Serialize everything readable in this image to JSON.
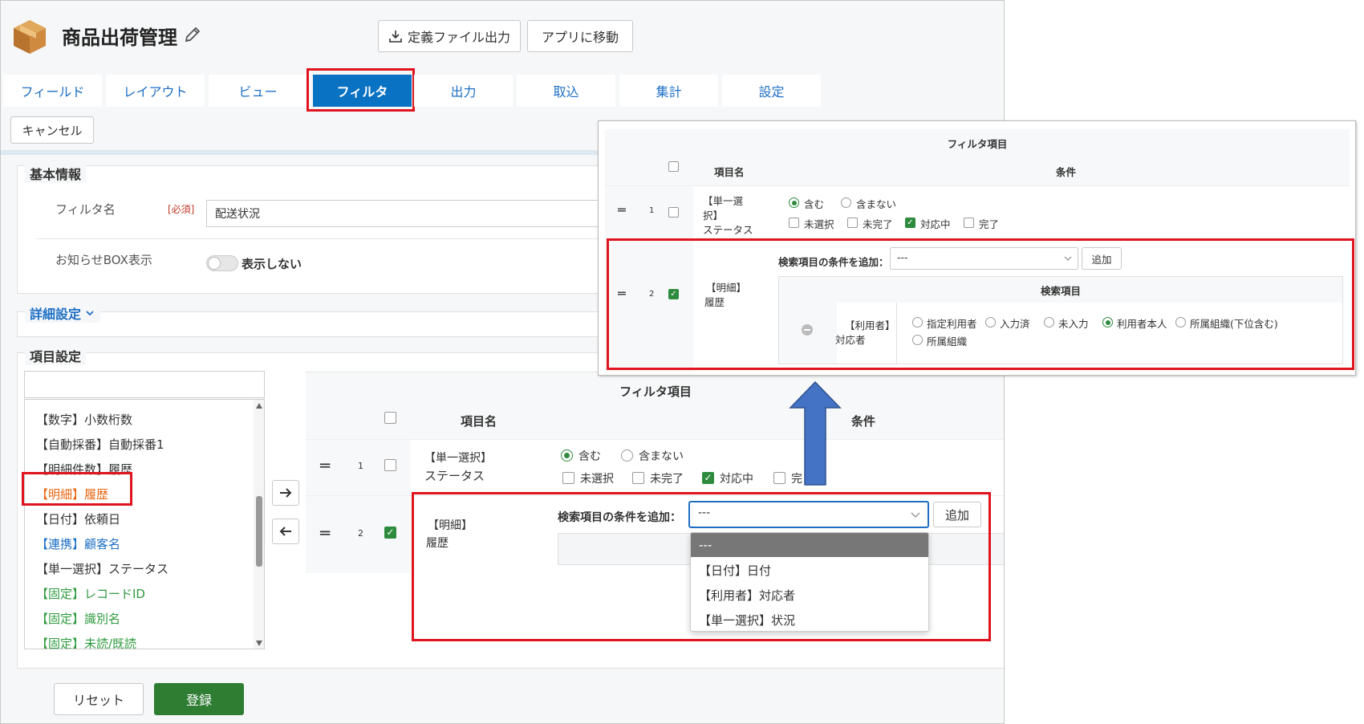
{
  "app": {
    "title": "商品出荷管理",
    "export_button": "定義ファイル出力",
    "goto_app_button": "アプリに移動",
    "cancel_button": "キャンセル"
  },
  "tabs": [
    {
      "label": "フィールド"
    },
    {
      "label": "レイアウト"
    },
    {
      "label": "ビュー"
    },
    {
      "label": "フィルタ"
    },
    {
      "label": "出力"
    },
    {
      "label": "取込"
    },
    {
      "label": "集計"
    },
    {
      "label": "設定"
    }
  ],
  "basic": {
    "section_title": "基本情報",
    "filter_name_label": "フィルタ名",
    "required": "[必須]",
    "filter_name_value": "配送状況",
    "notice_label": "お知らせBOX表示",
    "notice_toggle_text": "表示しない"
  },
  "detail": {
    "label": "詳細設定"
  },
  "items": {
    "section_title": "項目設定",
    "search_placeholder": "",
    "field_list": [
      {
        "label": "【数字】小数桁数",
        "color": "#333333"
      },
      {
        "label": "【自動採番】自動採番1",
        "color": "#333333"
      },
      {
        "label": "【明細件数】履歴",
        "color": "#333333"
      },
      {
        "label": "【明細】履歴",
        "color": "#e8650f"
      },
      {
        "label": "【日付】依頼日",
        "color": "#333333"
      },
      {
        "label": "【連携】顧客名",
        "color": "#1e6fc4"
      },
      {
        "label": "【単一選択】ステータス",
        "color": "#333333"
      },
      {
        "label": "【固定】レコードID",
        "color": "#2e9a3e"
      },
      {
        "label": "【固定】識別名",
        "color": "#2e9a3e"
      },
      {
        "label": "【固定】未読/既読",
        "color": "#2e9a3e"
      }
    ]
  },
  "filter_table": {
    "header": "フィルタ項目",
    "col_name": "項目名",
    "col_cond": "条件",
    "row1": {
      "num": "1",
      "name_line1": "【単一選択】",
      "name_line2": "ステータス",
      "radio_include": "含む",
      "radio_exclude": "含まない",
      "opts": [
        "未選択",
        "未完了",
        "対応中",
        "完"
      ]
    },
    "row2": {
      "num": "2",
      "name_line1": "【明細】",
      "name_line2": "履歴",
      "add_label": "検索項目の条件を追加：",
      "select_value": "---",
      "add_button": "追加"
    },
    "dropdown_options": [
      "---",
      "【日付】日付",
      "【利用者】対応者",
      "【単一選択】状況"
    ]
  },
  "inset": {
    "header": "フィルタ項目",
    "col_name": "項目名",
    "col_cond": "条件",
    "row1": {
      "num": "1",
      "name_lines": [
        "【単一選",
        "択】",
        "ステータス"
      ],
      "radio_include": "含む",
      "radio_exclude": "含まない",
      "opts": [
        "未選択",
        "未完了",
        "対応中",
        "完了"
      ]
    },
    "row2": {
      "num": "2",
      "name_line1": "【明細】",
      "name_line2": "履歴",
      "add_label": "検索項目の条件を追加：",
      "select_value": "---",
      "add_button": "追加",
      "sub_header": "検索項目",
      "sub_name_line1": "【利用者】",
      "sub_name_line2": "対応者",
      "sub_opts": [
        "指定利用者",
        "入力済",
        "未入力",
        "利用者本人",
        "所属組織(下位含む)",
        "所属組織"
      ]
    }
  },
  "footer": {
    "reset_button": "リセット",
    "register_button": "登録"
  },
  "colors": {
    "accent": "#0a72c2",
    "highlight": "#e0141e",
    "register": "#2e7d32",
    "arrow": "#4472c4"
  }
}
